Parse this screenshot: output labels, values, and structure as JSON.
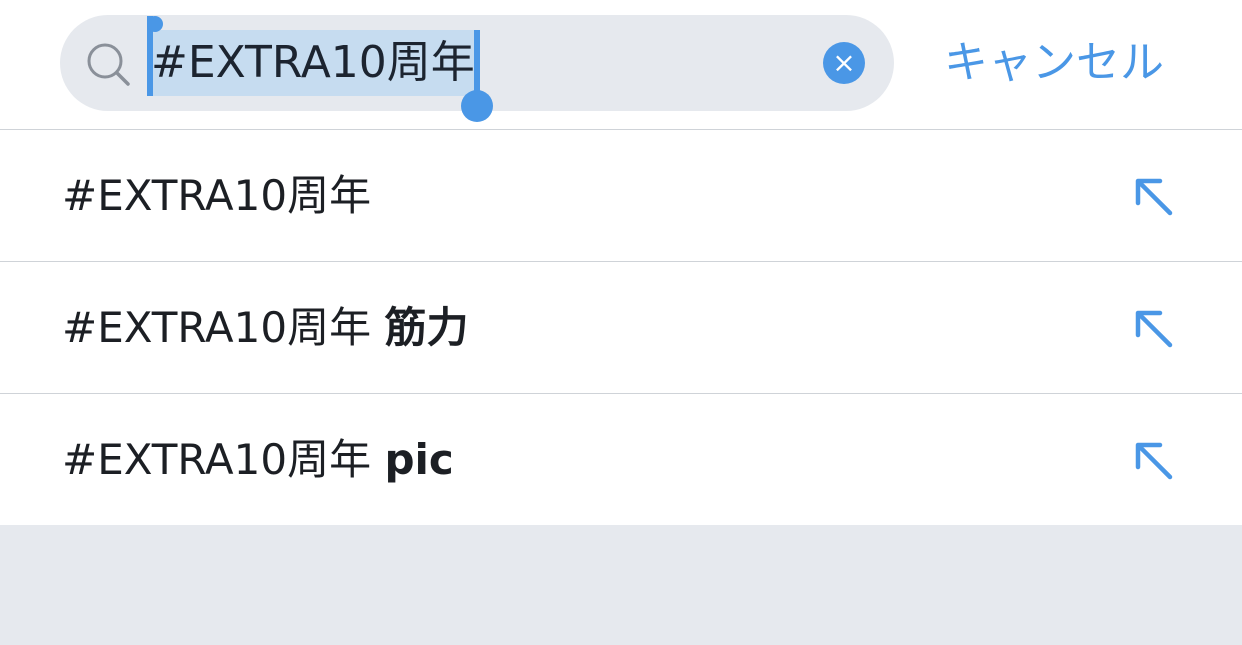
{
  "search": {
    "query": "#EXTRA10周年",
    "clear_symbol": "×",
    "cancel_label": "キャンセル"
  },
  "suggestions": [
    {
      "prefix": "#EXTRA10周年",
      "suffix": ""
    },
    {
      "prefix": "#EXTRA10周年 ",
      "suffix": "筋力"
    },
    {
      "prefix": "#EXTRA10周年 ",
      "suffix": "pic"
    }
  ],
  "icons": {
    "search": "search-icon",
    "clear": "close-icon",
    "fill": "arrow-up-left-icon"
  },
  "colors": {
    "accent": "#4a97e6",
    "search_bg": "#e6e9ee",
    "selection": "#c6dcf0",
    "text": "#1c1f24"
  }
}
